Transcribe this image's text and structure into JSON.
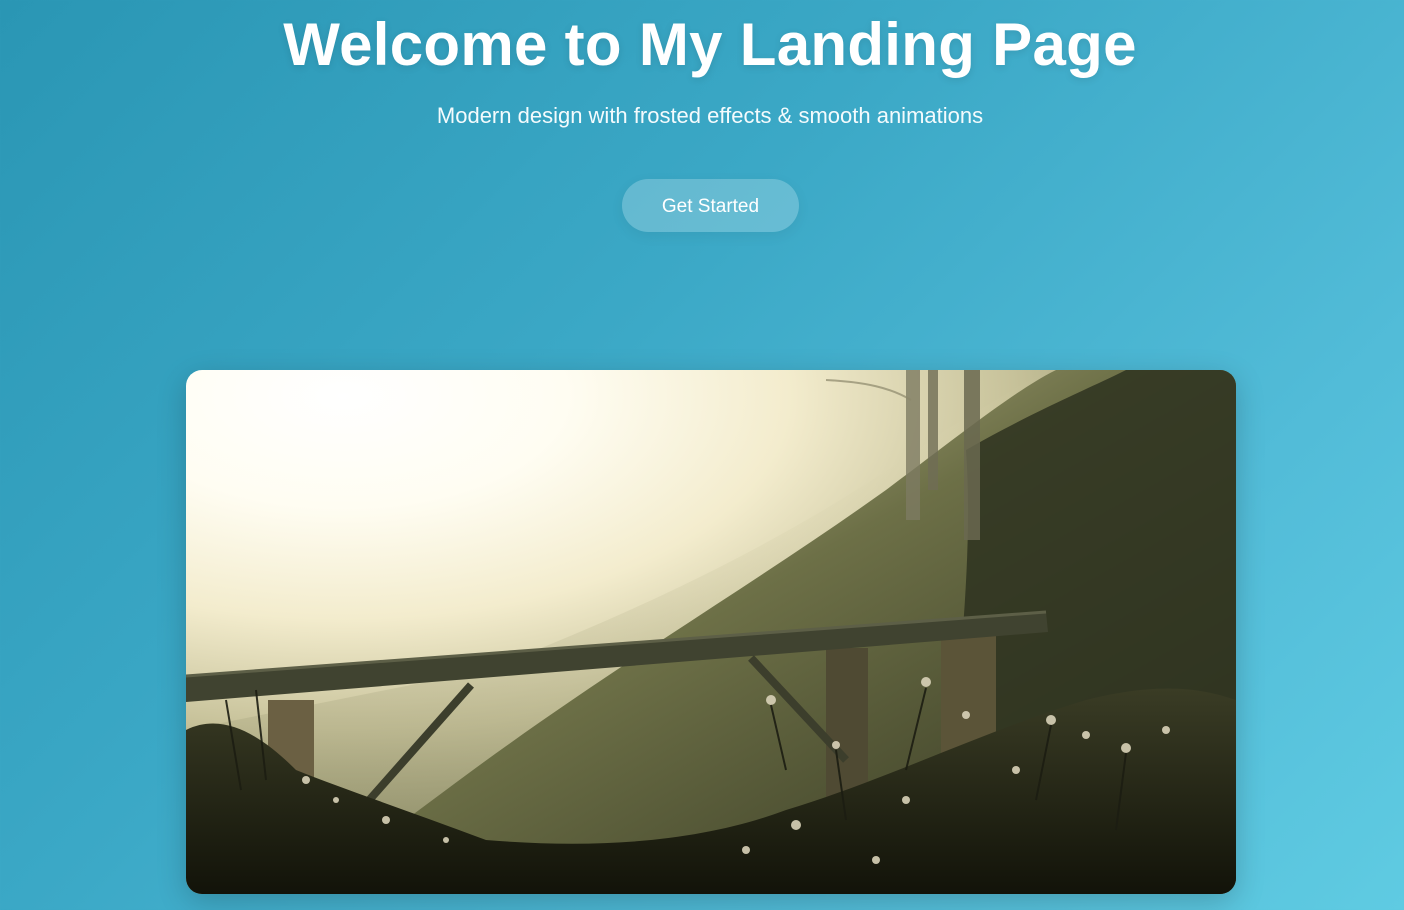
{
  "hero": {
    "title": "Welcome to My Landing Page",
    "subtitle": "Modern design with frosted effects & smooth animations",
    "cta_label": "Get Started"
  },
  "image": {
    "icon": "landscape-photo",
    "subject": "misty mountainside with pipeline bridge"
  },
  "colors": {
    "background_start": "#2a96b4",
    "background_end": "#5fcbe2",
    "text": "#ffffff",
    "button_fill": "rgba(255,255,255,0.22)"
  }
}
